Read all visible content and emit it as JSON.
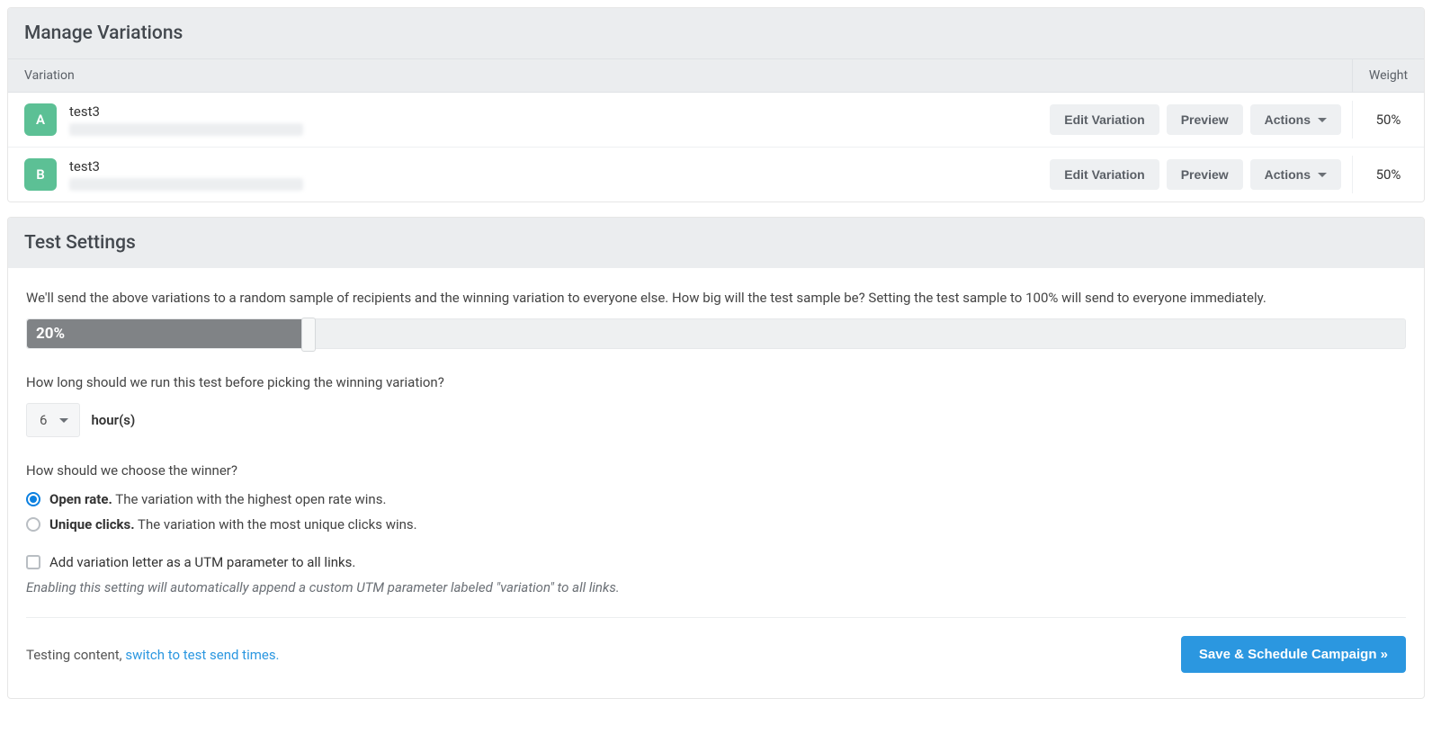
{
  "manage": {
    "title": "Manage Variations",
    "columns": {
      "variation": "Variation",
      "weight": "Weight"
    },
    "buttons": {
      "edit": "Edit Variation",
      "preview": "Preview",
      "actions": "Actions"
    },
    "rows": [
      {
        "letter": "A",
        "name": "test3",
        "weight": "50%"
      },
      {
        "letter": "B",
        "name": "test3",
        "weight": "50%"
      }
    ]
  },
  "settings": {
    "title": "Test Settings",
    "sample_text": "We'll send the above variations to a random sample of recipients and the winning variation to everyone else. How big will the test sample be? Setting the test sample to 100% will send to everyone immediately.",
    "sample_percent_label": "20%",
    "sample_percent_value": 20,
    "duration_text": "How long should we run this test before picking the winning variation?",
    "duration_value": "6",
    "duration_unit": "hour(s)",
    "winner_text": "How should we choose the winner?",
    "options": {
      "open_rate": {
        "label": "Open rate.",
        "desc": " The variation with the highest open rate wins.",
        "selected": true
      },
      "unique_clicks": {
        "label": "Unique clicks.",
        "desc": " The variation with the most unique clicks wins.",
        "selected": false
      }
    },
    "utm_checkbox": {
      "label": "Add variation letter as a UTM parameter to all links.",
      "checked": false
    },
    "utm_helper": "Enabling this setting will automatically append a custom UTM parameter labeled \"variation\" to all links.",
    "footer_prefix": "Testing content, ",
    "footer_link": "switch to test send times.",
    "primary_button": "Save & Schedule Campaign »"
  }
}
